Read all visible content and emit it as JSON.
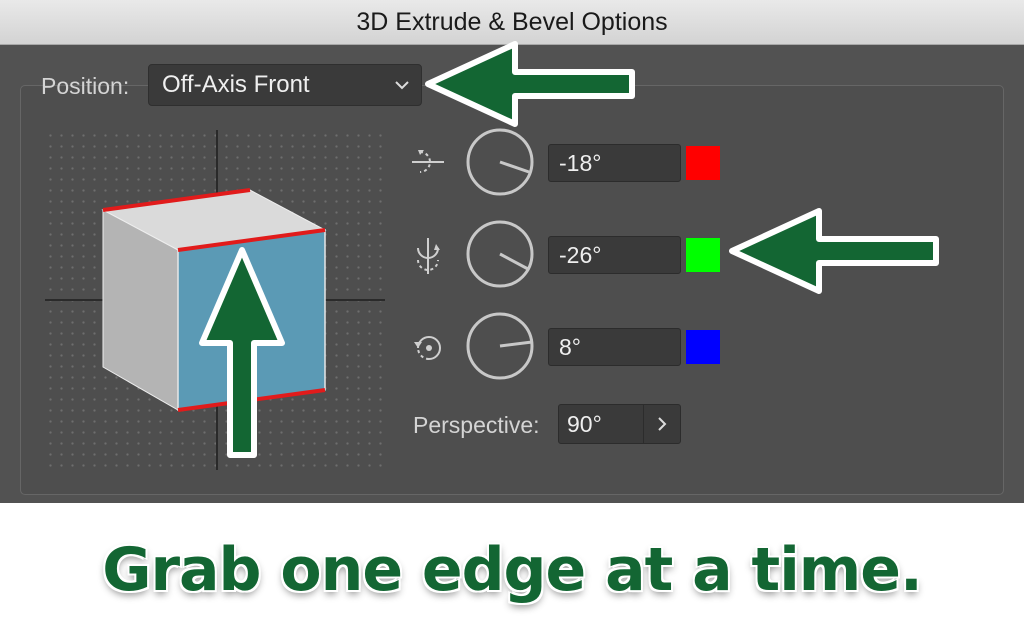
{
  "window": {
    "title": "3D Extrude & Bevel Options"
  },
  "position": {
    "label": "Position:",
    "value": "Off-Axis Front"
  },
  "rotation": [
    {
      "axis": "x",
      "icon": "x-axis-rotate-icon",
      "value": "-18°",
      "color": "#ff0000"
    },
    {
      "axis": "y",
      "icon": "y-axis-rotate-icon",
      "value": "-26°",
      "color": "#00ff00"
    },
    {
      "axis": "z",
      "icon": "z-axis-rotate-icon",
      "value": "8°",
      "color": "#0000ff"
    }
  ],
  "perspective": {
    "label": "Perspective:",
    "value": "90°"
  },
  "caption": "Grab one edge at a time.",
  "colors": {
    "cube_front": "#5b9ab5",
    "cube_side": "#b4b4b4",
    "cube_top": "#dadada",
    "edge_highlight": "#e11b1b",
    "arrow_green": "#136633"
  }
}
